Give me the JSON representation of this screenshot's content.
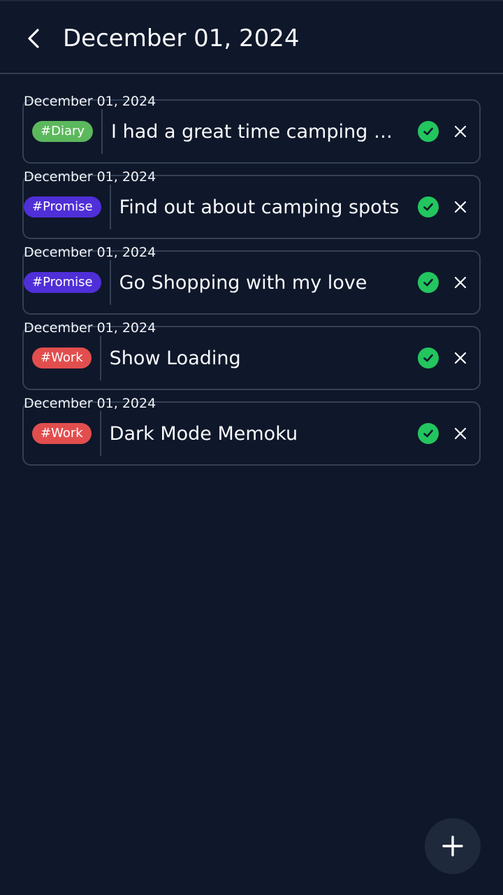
{
  "header": {
    "title": "December 01, 2024",
    "back_icon": "chevron-left-icon"
  },
  "colors": {
    "background": "#0f172a",
    "border": "#334155",
    "diary": "#5cb85c",
    "promise": "#4f2fd8",
    "work": "#e24e4e",
    "check": "#22c55e"
  },
  "memos": [
    {
      "date": "December 01, 2024",
      "tag": "#Diary",
      "tag_color": "#5cb85c",
      "text": "I had a great time camping with my family and friends"
    },
    {
      "date": "December 01, 2024",
      "tag": "#Promise",
      "tag_color": "#4f2fd8",
      "text": "Find out about camping spots"
    },
    {
      "date": "December 01, 2024",
      "tag": "#Promise",
      "tag_color": "#4f2fd8",
      "text": "Go Shopping with my love"
    },
    {
      "date": "December 01, 2024",
      "tag": "#Work",
      "tag_color": "#e24e4e",
      "text": "Show Loading"
    },
    {
      "date": "December 01, 2024",
      "tag": "#Work",
      "tag_color": "#e24e4e",
      "text": "Dark Mode Memoku"
    }
  ],
  "fab": {
    "icon": "plus-icon"
  }
}
